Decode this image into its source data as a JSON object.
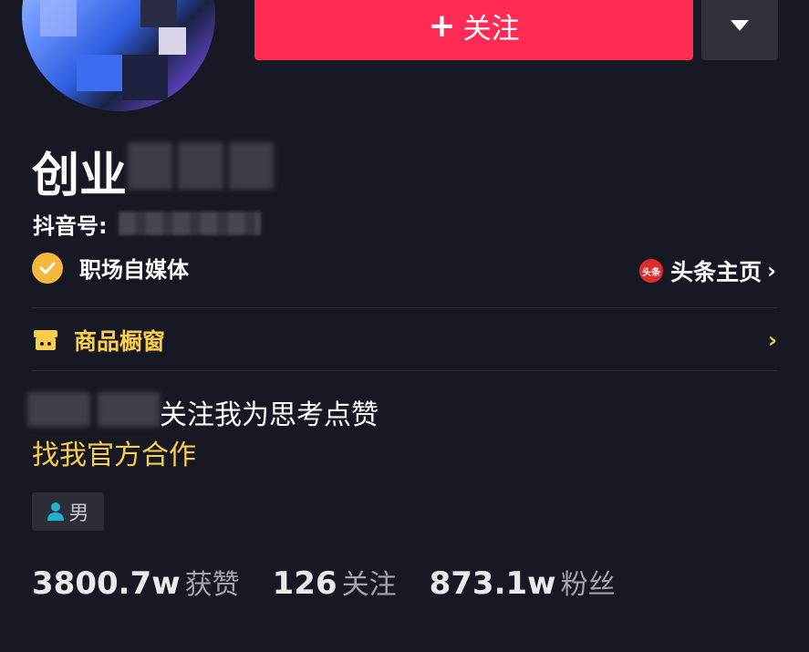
{
  "header": {
    "follow_label": "关注",
    "follow_prefix": "+"
  },
  "profile": {
    "name": "创业",
    "id_label": "抖音号:",
    "verification": "职场自媒体",
    "toutiao_icon_text": "头条",
    "toutiao_link": "头条主页",
    "shop_label": "商品橱窗",
    "bio_line1": "关注我为思考点赞",
    "bio_line2": "找我官方合作",
    "gender": "男"
  },
  "stats": [
    {
      "value": "3800.7w",
      "label": "获赞"
    },
    {
      "value": "126",
      "label": "关注"
    },
    {
      "value": "873.1w",
      "label": "粉丝"
    }
  ],
  "colors": {
    "background": "#161823",
    "follow_button": "#fe2c55",
    "accent_yellow": "#facd4d",
    "verify_badge": "#f5b83d"
  }
}
